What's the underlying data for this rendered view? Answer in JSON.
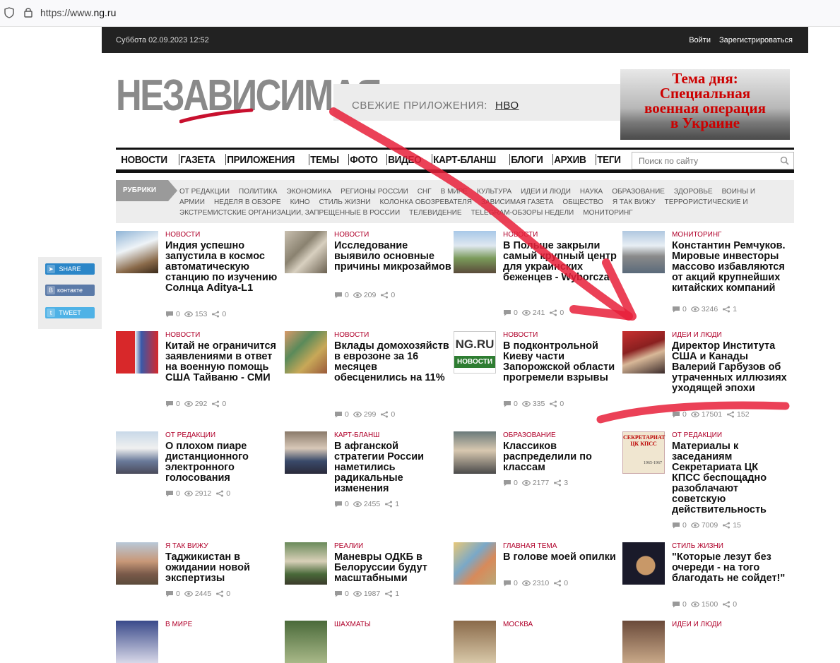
{
  "browser": {
    "url_prefix": "https://www.",
    "url_domain": "ng.ru"
  },
  "topbar": {
    "date": "Суббота 02.09.2023   12:52",
    "login": "Войти",
    "register": "Зарегистрироваться"
  },
  "header": {
    "logo": "НЕЗАВИСИМАЯ",
    "apps_label": "СВЕЖИЕ ПРИЛОЖЕНИЯ:",
    "apps_link": "НВО",
    "banner_lines": [
      "Тема дня:",
      "Специальная",
      "военная операция",
      "в Украине"
    ]
  },
  "nav": {
    "items": [
      "НОВОСТИ",
      "ГАЗЕТА",
      "ПРИЛОЖЕНИЯ",
      "ТЕМЫ",
      "ФОТО",
      "ВИДЕО",
      "КАРТ-БЛАНШ",
      "БЛОГИ",
      "АРХИВ",
      "ТЕГИ"
    ],
    "search_placeholder": "Поиск по сайту"
  },
  "rubrics": {
    "label": "РУБРИКИ",
    "items": [
      "ОТ РЕДАКЦИИ",
      "ПОЛИТИКА",
      "ЭКОНОМИКА",
      "РЕГИОНЫ РОССИИ",
      "СНГ",
      "В МИРЕ",
      "КУЛЬТУРА",
      "ИДЕИ И ЛЮДИ",
      "НАУКА",
      "ОБРАЗОВАНИЕ",
      "ЗДОРОВЬЕ",
      "ВОИНЫ И АРМИИ",
      "НЕДЕЛЯ В ОБЗОРЕ",
      "КИНО",
      "СТИЛЬ ЖИЗНИ",
      "КОЛОНКА ОБОЗРЕВАТЕЛЯ",
      "ЗАВИСИМАЯ ГАЗЕТА",
      "ОБЩЕСТВО",
      "Я ТАК ВИЖУ",
      "ТЕРРОРИСТИЧЕСКИЕ И ЭКСТРЕМИСТСКИЕ ОРГАНИЗАЦИИ, ЗАПРЕЩЕННЫЕ В РОССИИ",
      "ТЕЛЕВИДЕНИЕ",
      "TELEGRAM-ОБЗОРЫ НЕДЕЛИ",
      "МОНИТОРИНГ"
    ]
  },
  "share": {
    "telegram": "SHARE",
    "vk": "контакте",
    "twitter": "TWEET"
  },
  "articles": [
    {
      "cat": "НОВОСТИ",
      "title": "Индия успешно запустила в космос автоматическую станцию по изучению Солнца Aditya-L1",
      "comments": "0",
      "views": "153",
      "shares": "0"
    },
    {
      "cat": "НОВОСТИ",
      "title": "Исследование выявило основные причины микрозаймов",
      "comments": "0",
      "views": "209",
      "shares": "0"
    },
    {
      "cat": "НОВОСТИ",
      "title": "В Польше закрыли самый крупный центр для украинских беженцев - Wyborcza",
      "comments": "0",
      "views": "241",
      "shares": "0"
    },
    {
      "cat": "МОНИТОРИНГ",
      "title": "Константин Ремчуков. Мировые инвесторы массово избавляются от акций крупнейших китайских компаний",
      "comments": "0",
      "views": "3246",
      "shares": "1"
    },
    {
      "cat": "НОВОСТИ",
      "title": "Китай не ограничится заявлениями в ответ на военную помощь США Тайваню - СМИ",
      "comments": "0",
      "views": "292",
      "shares": "0"
    },
    {
      "cat": "НОВОСТИ",
      "title": "Вклады домохозяйств в еврозоне за 16 месяцев обесценились на 11%",
      "comments": "0",
      "views": "299",
      "shares": "0"
    },
    {
      "cat": "НОВОСТИ",
      "title": "В подконтрольной Киеву части Запорожской области прогремели взрывы",
      "comments": "0",
      "views": "335",
      "shares": "0"
    },
    {
      "cat": "ИДЕИ И ЛЮДИ",
      "title": "Директор Института США и Канады Валерий Гарбузов об утраченных иллюзиях уходящей эпохи",
      "comments": "0",
      "views": "17501",
      "shares": "152"
    },
    {
      "cat": "ОТ РЕДАКЦИИ",
      "title": "О плохом пиаре дистанционного электронного голосования",
      "comments": "0",
      "views": "2912",
      "shares": "0"
    },
    {
      "cat": "КАРТ-БЛАНШ",
      "title": "В афганской стратегии России наметились радикальные изменения",
      "comments": "0",
      "views": "2455",
      "shares": "1"
    },
    {
      "cat": "ОБРАЗОВАНИЕ",
      "title": "Классиков распределили по классам",
      "comments": "0",
      "views": "2177",
      "shares": "3"
    },
    {
      "cat": "ОТ РЕДАКЦИИ",
      "title": "Материалы к заседаниям Секретариата ЦК КПСС беспощадно разоблачают советскую действительность",
      "comments": "0",
      "views": "7009",
      "shares": "15"
    },
    {
      "cat": "Я ТАК ВИЖУ",
      "title": "Таджикистан в ожидании новой экспертизы",
      "comments": "0",
      "views": "2445",
      "shares": "0"
    },
    {
      "cat": "РЕАЛИИ",
      "title": "Маневры ОДКБ в Белоруссии будут масштабными",
      "comments": "0",
      "views": "1987",
      "shares": "1"
    },
    {
      "cat": "ГЛАВНАЯ ТЕМА",
      "title": "В голове моей опилки",
      "comments": "0",
      "views": "2310",
      "shares": "0"
    },
    {
      "cat": "СТИЛЬ ЖИЗНИ",
      "title": "\"Которые лезут без очереди - на того благодать не сойдет!\"",
      "comments": "0",
      "views": "1500",
      "shares": "0"
    },
    {
      "cat": "В МИРЕ",
      "title": "",
      "comments": "",
      "views": "",
      "shares": ""
    },
    {
      "cat": "ШАХМАТЫ",
      "title": "",
      "comments": "",
      "views": "",
      "shares": ""
    },
    {
      "cat": "МОСКВА",
      "title": "",
      "comments": "",
      "views": "",
      "shares": ""
    },
    {
      "cat": "ИДЕИ И ЛЮДИ",
      "title": "",
      "comments": "",
      "views": "",
      "shares": ""
    }
  ],
  "thumb_text": {
    "ngru": "NG.RU",
    "ngru_sub": "НОВОСТИ",
    "kpss_title": "СЕКРЕТАРИАТ ЦК КПСС",
    "kpss_years": "1965-1967"
  },
  "colors": {
    "accent_red": "#b0002a",
    "annotation_red": "#e8203a",
    "topbar_bg": "#222222"
  }
}
